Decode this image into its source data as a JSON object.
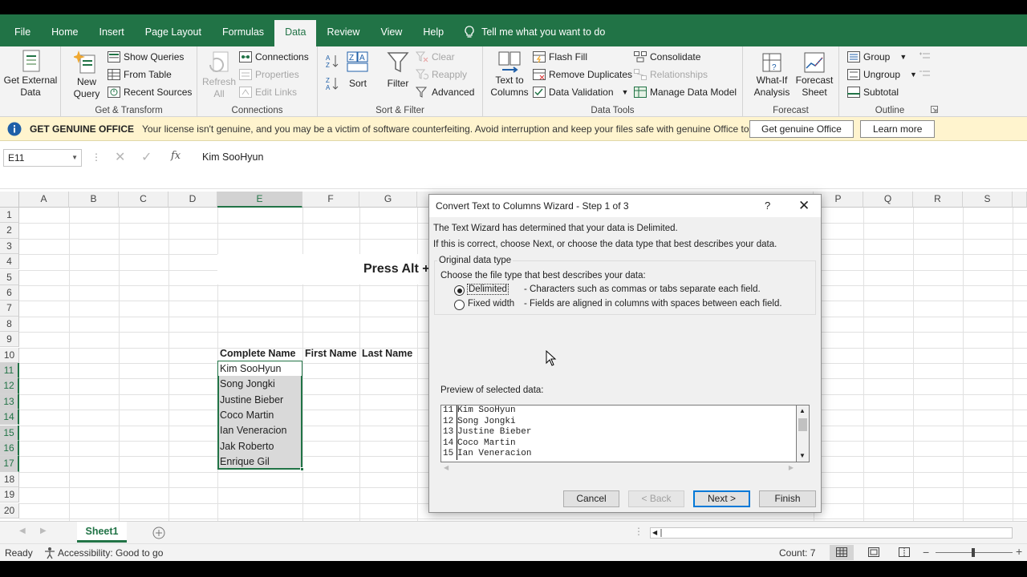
{
  "ribbon_tabs": [
    "File",
    "Home",
    "Insert",
    "Page Layout",
    "Formulas",
    "Data",
    "Review",
    "View",
    "Help"
  ],
  "active_tab": "Data",
  "tell_me": "Tell me what you want to do",
  "ribbon": {
    "get_external_data": [
      "Get External",
      "Data"
    ],
    "new_query": [
      "New",
      "Query"
    ],
    "show_queries": "Show Queries",
    "from_table": "From Table",
    "recent_sources": "Recent Sources",
    "get_transform_label": "Get & Transform",
    "refresh_all": [
      "Refresh",
      "All"
    ],
    "connections": "Connections",
    "properties": "Properties",
    "edit_links": "Edit Links",
    "connections_label": "Connections",
    "sort": "Sort",
    "filter": "Filter",
    "clear": "Clear",
    "reapply": "Reapply",
    "advanced": "Advanced",
    "sort_filter_label": "Sort & Filter",
    "text_to_columns": [
      "Text to",
      "Columns"
    ],
    "flash_fill": "Flash Fill",
    "remove_duplicates": "Remove Duplicates",
    "data_validation": "Data Validation",
    "consolidate": "Consolidate",
    "relationships": "Relationships",
    "manage_data_model": "Manage Data Model",
    "data_tools_label": "Data Tools",
    "what_if": [
      "What-If",
      "Analysis"
    ],
    "forecast_sheet": [
      "Forecast",
      "Sheet"
    ],
    "forecast_label": "Forecast",
    "group": "Group",
    "ungroup": "Ungroup",
    "subtotal": "Subtotal",
    "outline_label": "Outline"
  },
  "message_bar": {
    "title": "GET GENUINE OFFICE",
    "text": "Your license isn't genuine, and you may be a victim of software counterfeiting. Avoid interruption and keep your files safe with genuine Office today.",
    "btn_genuine": "Get genuine Office",
    "btn_learn": "Learn more"
  },
  "formula_bar": {
    "name_box": "E11",
    "fx": "fx",
    "content": "Kim SooHyun"
  },
  "columns": [
    "A",
    "B",
    "C",
    "D",
    "E",
    "F",
    "G",
    "P",
    "Q",
    "R",
    "S"
  ],
  "rows": [
    "1",
    "2",
    "3",
    "4",
    "5",
    "6",
    "7",
    "8",
    "9",
    "10",
    "11",
    "12",
    "13",
    "14",
    "15",
    "16",
    "17",
    "18",
    "19",
    "20"
  ],
  "sheet": {
    "press_text": "Press Alt +",
    "headers": [
      "Complete Name",
      "First Name",
      "Last Name"
    ],
    "names": [
      "Kim SooHyun",
      "Song Jongki",
      "Justine Bieber",
      "Coco Martin",
      "Ian Veneracion",
      "Jak Roberto",
      "Enrique Gil"
    ]
  },
  "sheet_tab": "Sheet1",
  "status": {
    "ready": "Ready",
    "accessibility": "Accessibility: Good to go",
    "count": "Count: 7"
  },
  "dialog": {
    "title": "Convert Text to Columns Wizard - Step 1 of 3",
    "help": "?",
    "line1": "The Text Wizard has determined that your data is Delimited.",
    "line2": "If this is correct, choose Next, or choose the data type that best describes your data.",
    "group_title": "Original data type",
    "choose_label": "Choose the file type that best describes your data:",
    "opt_delimited": "Delimited",
    "opt_delimited_desc": "- Characters such as commas or tabs separate each field.",
    "opt_fixed": "Fixed width",
    "opt_fixed_desc": "- Fields are aligned in columns with spaces between each field.",
    "preview_label": "Preview of selected data:",
    "preview": [
      {
        "n": "11",
        "t": "Kim SooHyun"
      },
      {
        "n": "12",
        "t": "Song Jongki"
      },
      {
        "n": "13",
        "t": "Justine Bieber"
      },
      {
        "n": "14",
        "t": "Coco Martin"
      },
      {
        "n": "15",
        "t": "Ian Veneracion"
      }
    ],
    "cancel": "Cancel",
    "back": "< Back",
    "next": "Next >",
    "finish": "Finish"
  }
}
